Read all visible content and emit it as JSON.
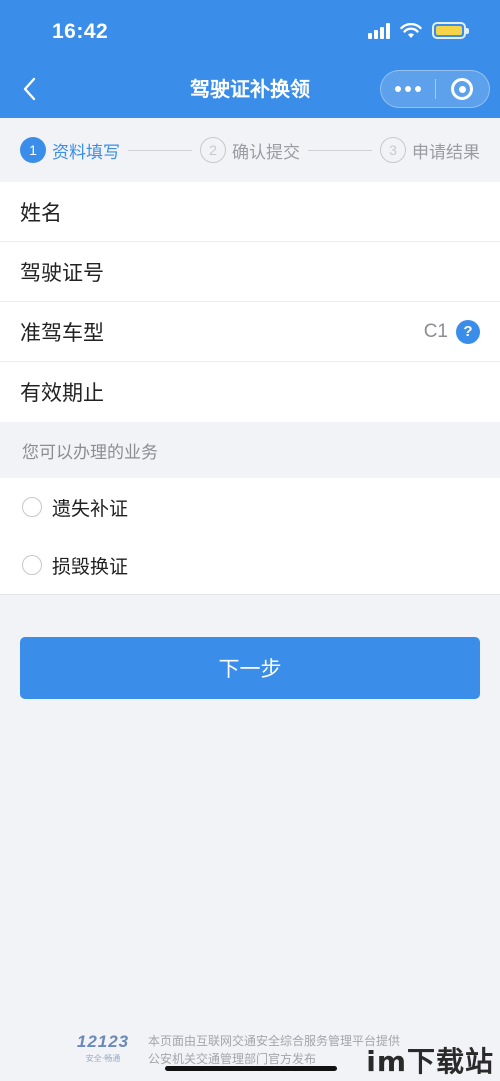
{
  "status_bar": {
    "time": "16:42"
  },
  "nav": {
    "title": "驾驶证补换领"
  },
  "steps": [
    {
      "num": "1",
      "label": "资料填写",
      "state": "active"
    },
    {
      "num": "2",
      "label": "确认提交",
      "state": "inactive"
    },
    {
      "num": "3",
      "label": "申请结果",
      "state": "inactive"
    }
  ],
  "form": {
    "name_label": "姓名",
    "license_label": "驾驶证号",
    "class_label": "准驾车型",
    "class_value": "C1",
    "help_icon": "?",
    "expiry_label": "有效期止"
  },
  "services": {
    "title": "您可以办理的业务",
    "options": [
      "遗失补证",
      "损毁换证"
    ]
  },
  "next_button": "下一步",
  "footer": {
    "logo_number": "12123",
    "logo_tagline": "安全·畅通",
    "line1": "本页面由互联网交通安全综合服务管理平台提供",
    "line2": "公安机关交通管理部门官方发布"
  },
  "watermark": "im下载站",
  "colors": {
    "accent": "#3a8de8",
    "battery": "#f5d547",
    "background": "#f2f3f7"
  }
}
